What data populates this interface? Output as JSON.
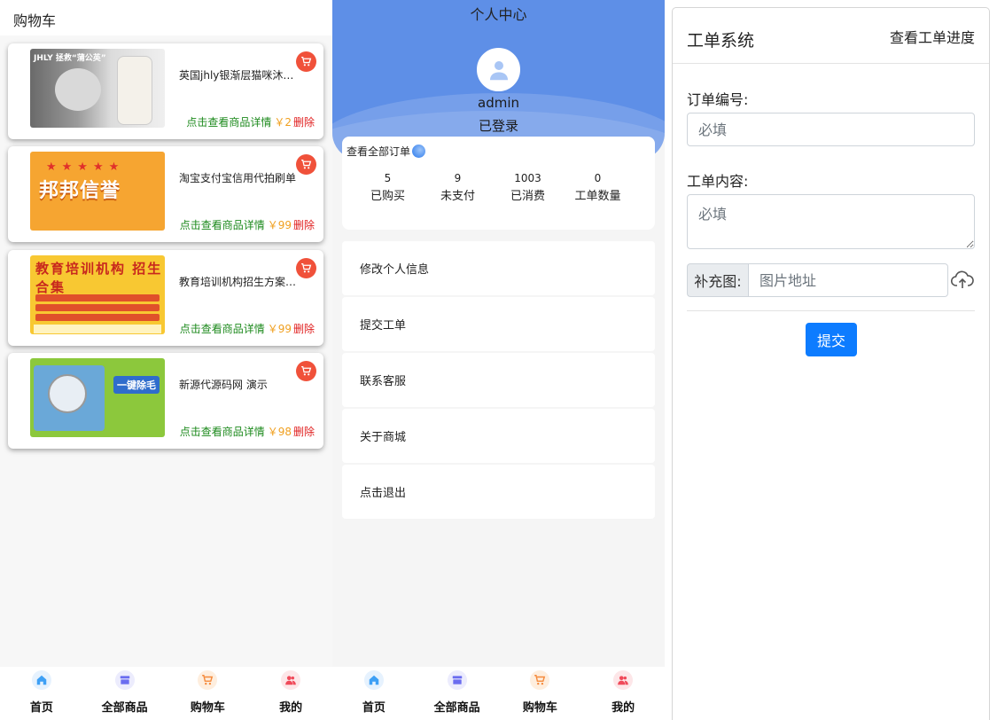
{
  "cart": {
    "title": "购物车",
    "items": [
      {
        "name": "英国jhly银渐层猫咪沐浴露",
        "detail_label": "点击查看商品详情",
        "price": "￥2",
        "delete_label": "删除",
        "image_text": "JHLY 拯救“蒲公英”"
      },
      {
        "name": "淘宝支付宝信用代拍刷单",
        "detail_label": "点击查看商品详情",
        "price": "￥99",
        "delete_label": "删除",
        "image_text": "邦邦信誉"
      },
      {
        "name": "教育培训机构招生方案合集",
        "detail_label": "点击查看商品详情",
        "price": "￥99",
        "delete_label": "删除",
        "image_text": "教育培训机构 招生合集"
      },
      {
        "name": "新源代源码网 演示",
        "detail_label": "点击查看商品详情",
        "price": "￥98",
        "delete_label": "删除",
        "image_text": "一键除毛"
      }
    ]
  },
  "nav": [
    {
      "label": "首页",
      "icon": "home-icon",
      "color": "#3ea0f5"
    },
    {
      "label": "全部商品",
      "icon": "store-icon",
      "color": "#6a6cf0"
    },
    {
      "label": "购物车",
      "icon": "cart-icon",
      "color": "#f5893a"
    },
    {
      "label": "我的",
      "icon": "user-icon",
      "color": "#f04a5a"
    }
  ],
  "profile": {
    "title": "个人中心",
    "username": "admin",
    "status": "已登录",
    "orders_link": "查看全部订单",
    "stats": [
      {
        "value": "5",
        "label": "已购买"
      },
      {
        "value": "9",
        "label": "未支付"
      },
      {
        "value": "1003",
        "label": "已消费"
      },
      {
        "value": "0",
        "label": "工单数量"
      }
    ],
    "menu": [
      "修改个人信息",
      "提交工单",
      "联系客服",
      "关于商城",
      "点击退出"
    ]
  },
  "ticket": {
    "title": "工单系统",
    "progress_link": "查看工单进度",
    "order_label": "订单编号:",
    "order_placeholder": "必填",
    "content_label": "工单内容:",
    "content_placeholder": "必填",
    "image_label": "补充图:",
    "image_placeholder": "图片地址",
    "submit_label": "提交"
  },
  "colors": {
    "hero_blue": "#5e8fe7",
    "submit_blue": "#0d7cff",
    "cart_badge": "#f0513a",
    "detail_green": "#1d8a1d",
    "price_orange": "#f0a020",
    "delete_red": "#e02020"
  }
}
